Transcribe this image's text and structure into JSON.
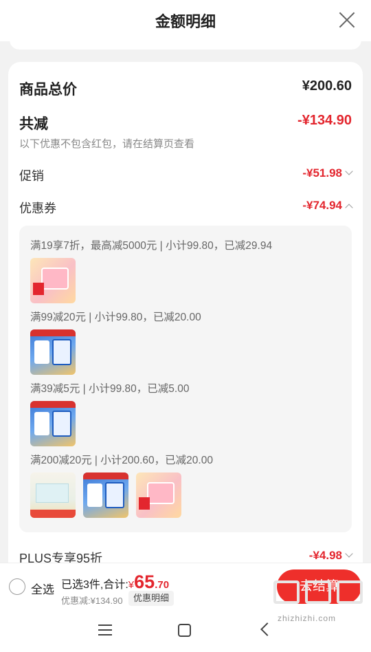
{
  "header": {
    "title": "金额明细"
  },
  "summary": {
    "total_label": "商品总价",
    "total_value": "¥200.60",
    "reduce_label": "共减",
    "reduce_value": "-¥134.90",
    "note": "以下优惠不包含红包，请在结算页查看",
    "promo_label": "促销",
    "promo_value": "-¥51.98",
    "coupon_label": "优惠券",
    "coupon_value": "-¥74.94",
    "plus_label": "PLUS专享95折",
    "plus_value": "-¥4.98"
  },
  "coupons": [
    {
      "text": "满19享7折，最高减5000元 | 小计99.80，已减29.94"
    },
    {
      "text": "满99减20元 | 小计99.80，已减20.00"
    },
    {
      "text": "满39减5元 | 小计99.80，已减5.00"
    },
    {
      "text": "满200减20元 | 小计200.60，已减20.00"
    }
  ],
  "bottom_bar": {
    "select_all": "全选",
    "selected_text": "已选3件,合计:",
    "currency": "¥",
    "amount_int": "65",
    "amount_dec": ".70",
    "discount_text": "优惠减:¥134.90",
    "detail_button": "优惠明细",
    "checkout_button": "去结算"
  },
  "watermark": {
    "text": "zhizhizhi.com"
  },
  "colors": {
    "accent": "#e3262e",
    "checkout_bg": "#ee2f2b"
  }
}
